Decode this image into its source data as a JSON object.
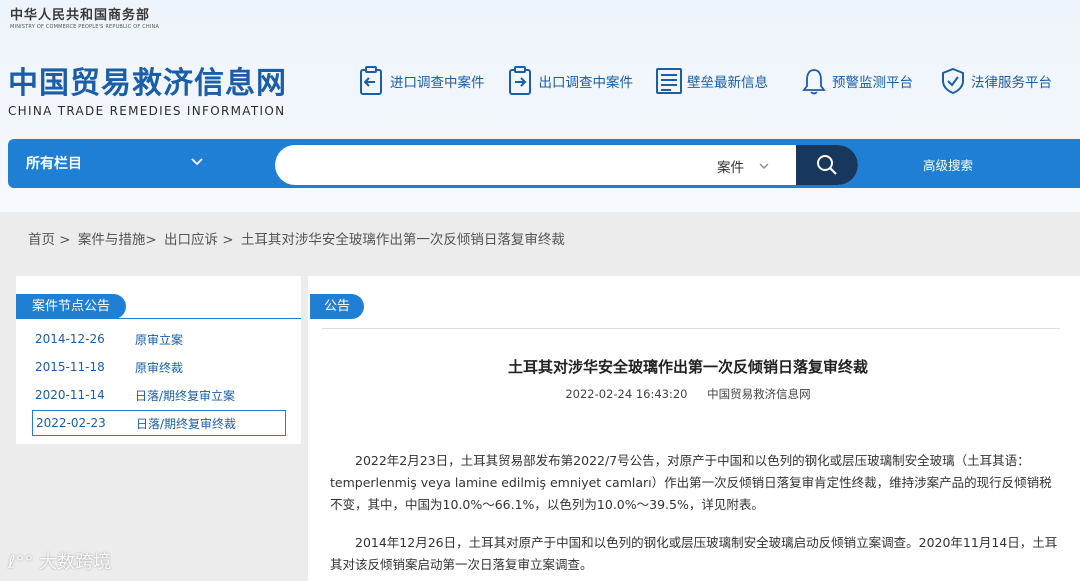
{
  "ministry": {
    "cn": "中华人民共和国商务部",
    "en": "MINISTRY OF COMMERCE PEOPLE'S REPUBLIC OF CHINA"
  },
  "site": {
    "cn": "中国贸易救济信息网",
    "en": "CHINA TRADE REMEDIES INFORMATION"
  },
  "nav": [
    {
      "label": "进口调查中案件",
      "icon": "import-case-icon"
    },
    {
      "label": "出口调查中案件",
      "icon": "export-case-icon"
    },
    {
      "label": "壁垒最新信息",
      "icon": "barrier-news-icon"
    },
    {
      "label": "预警监测平台",
      "icon": "bell-icon"
    },
    {
      "label": "法律服务平台",
      "icon": "shield-check-icon"
    }
  ],
  "search": {
    "all_columns": "所有栏目",
    "placeholder": "",
    "type": "案件",
    "advanced": "高级搜索"
  },
  "breadcrumb": [
    "首页 >",
    "案件与措施>",
    "出口应诉 >",
    "土耳其对涉华安全玻璃作出第一次反倾销日落复审终裁"
  ],
  "sidebar": {
    "title": "案件节点公告",
    "items": [
      {
        "date": "2014-12-26",
        "label": "原审立案"
      },
      {
        "date": "2015-11-18",
        "label": "原审终裁"
      },
      {
        "date": "2020-11-14",
        "label": "日落/期终复审立案"
      },
      {
        "date": "2022-02-23",
        "label": "日落/期终复审终裁"
      }
    ]
  },
  "article": {
    "tag": "公告",
    "title": "土耳其对涉华安全玻璃作出第一次反倾销日落复审终裁",
    "time": "2022-02-24 16:43:20",
    "source": "中国贸易救济信息网",
    "p1": "2022年2月23日，土耳其贸易部发布第2022/7号公告，对原产于中国和以色列的钢化或层压玻璃制安全玻璃（土耳其语：temperlenmiş veya lamine edilmiş emniyet camları）作出第一次反倾销日落复审肯定性终裁，维持涉案产品的现行反倾销税不变，其中，中国为10.0%～66.1%，以色列为10.0%～39.5%，详见附表。",
    "p2": "2014年12月26日，土耳其对原产于中国和以色列的钢化或层压玻璃制安全玻璃启动反倾销立案调查。2020年11月14日，土耳其对该反倾销案启动第一次日落复审立案调查。"
  },
  "watermark": "大数跨境",
  "colors": {
    "accent": "#1f7fd4",
    "brand": "#1a5ea8",
    "search_btn": "#17375c"
  }
}
